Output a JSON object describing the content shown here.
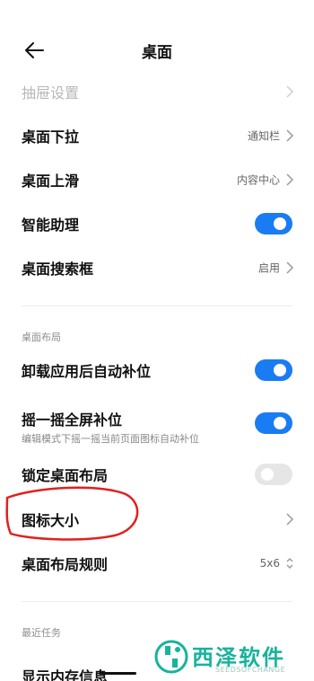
{
  "header": {
    "title": "桌面",
    "back_icon": "arrow-left-icon"
  },
  "rows": {
    "drawer": {
      "label": "抽屉设置"
    },
    "pull_down": {
      "label": "桌面下拉",
      "value": "通知栏"
    },
    "swipe_up": {
      "label": "桌面上滑",
      "value": "内容中心"
    },
    "assistant": {
      "label": "智能助理",
      "toggle": "on"
    },
    "search_box": {
      "label": "桌面搜索框",
      "value": "启用"
    },
    "uninstall_fill": {
      "label": "卸载应用后自动补位",
      "toggle": "on"
    },
    "shake_fill": {
      "label": "摇一摇全屏补位",
      "sub": "编辑模式下摇一摇当前页面图标自动补位",
      "toggle": "on"
    },
    "lock_layout": {
      "label": "锁定桌面布局",
      "toggle": "off"
    },
    "icon_size": {
      "label": "图标大小"
    },
    "layout_rule": {
      "label": "桌面布局规则",
      "value": "5x6"
    },
    "memory_info": {
      "label": "显示内存信息"
    }
  },
  "sections": {
    "layout": "桌面布局",
    "recent": "最近任务"
  },
  "watermark": {
    "text": "西泽软件",
    "sub": "SEEDSOFCHANGE"
  },
  "colors": {
    "accent": "#1a7cf3",
    "annotation": "#e0211f",
    "watermark": "#17b39c"
  }
}
